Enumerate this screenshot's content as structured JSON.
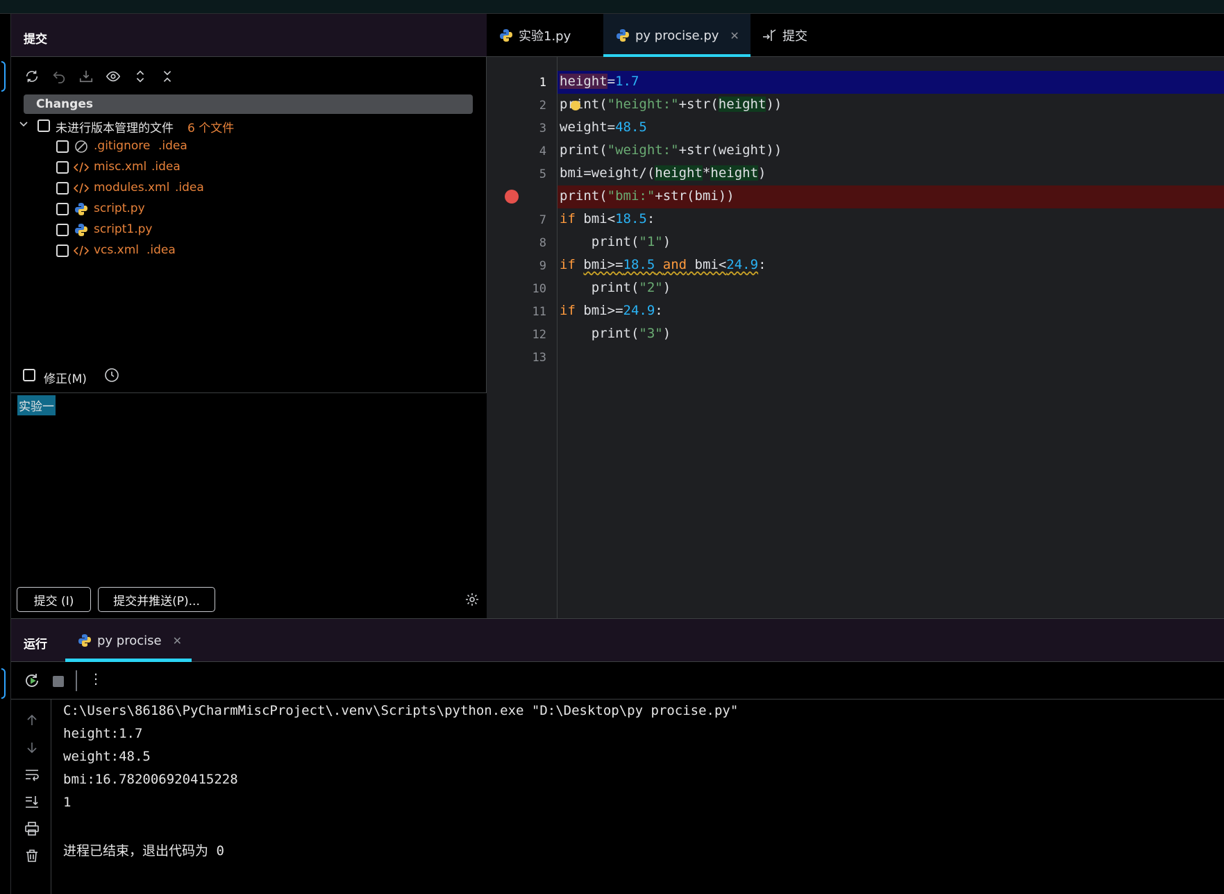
{
  "commit_panel": {
    "title": "提交",
    "changes_label": "Changes",
    "unversioned_label": "未进行版本管理的文件",
    "unversioned_count": "6 个文件",
    "files": [
      {
        "name": ".gitignore",
        "dir": ".idea",
        "icon": "ignore-file-icon"
      },
      {
        "name": "misc.xml",
        "dir": ".idea",
        "icon": "xml-file-icon"
      },
      {
        "name": "modules.xml",
        "dir": ".idea",
        "icon": "xml-file-icon"
      },
      {
        "name": "script.py",
        "dir": "",
        "icon": "python-file-icon"
      },
      {
        "name": "script1.py",
        "dir": "",
        "icon": "python-file-icon"
      },
      {
        "name": "vcs.xml",
        "dir": ".idea",
        "icon": "xml-file-icon"
      }
    ],
    "amend_label": "修正(M)",
    "commit_message": "实验一",
    "commit_button": "提交 (I)",
    "commit_push_button": "提交并推送(P)..."
  },
  "editor": {
    "tabs": [
      {
        "label": "实验1.py",
        "active": false
      },
      {
        "label": "py procise.py",
        "active": true
      },
      {
        "label": "提交",
        "active": false
      }
    ],
    "line_numbers": [
      "1",
      "2",
      "3",
      "4",
      "5",
      "7",
      "8",
      "9",
      "10",
      "11",
      "12",
      "13"
    ]
  },
  "run_panel": {
    "title": "运行",
    "tab_label": "py procise",
    "output": [
      "C:\\Users\\86186\\PyCharmMiscProject\\.venv\\Scripts\\python.exe \"D:\\Desktop\\py procise.py\"",
      "height:1.7",
      "weight:48.5",
      "bmi:16.782006920415228",
      "1",
      "",
      "进程已结束，退出代码为 0"
    ]
  },
  "colors": {
    "accent": "#2bd3f3",
    "keyword": "#ff9a3d",
    "number": "#2ab3f5",
    "string": "#6aab73",
    "unversioned": "#e8823a",
    "breakpoint": "#e5514c"
  }
}
